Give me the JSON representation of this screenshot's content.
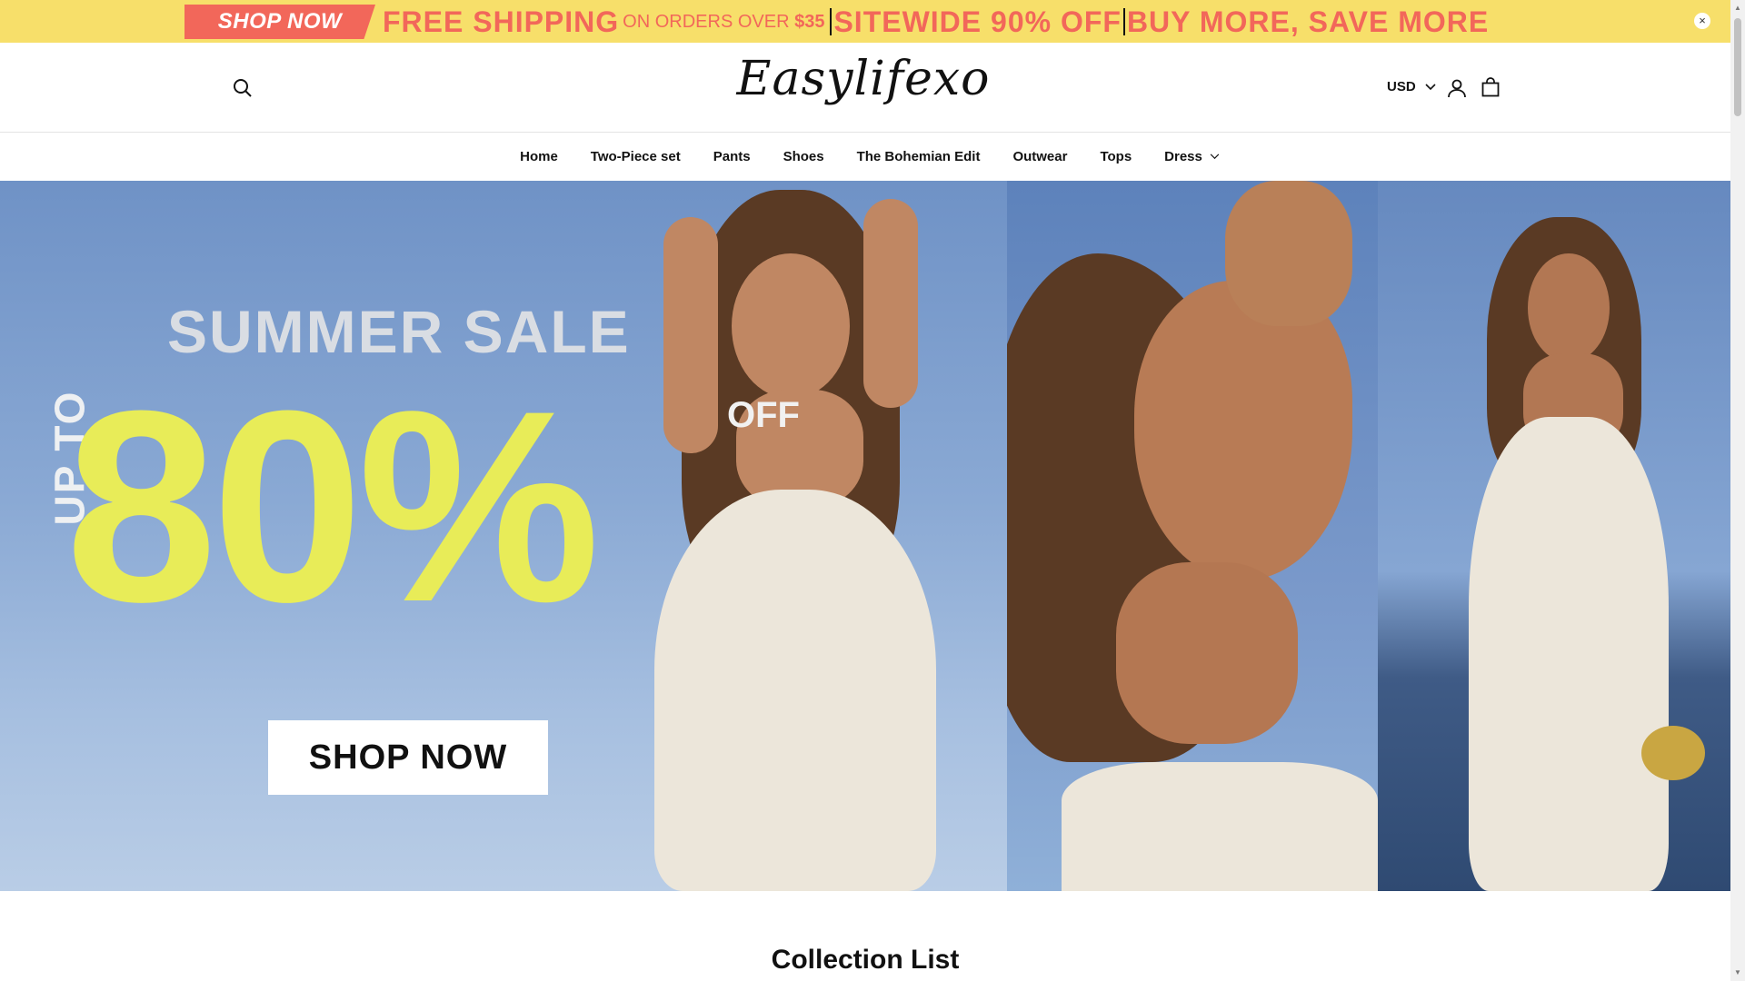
{
  "announcement": {
    "tag": "SHOP NOW",
    "free_shipping": "FREE SHIPPING",
    "orders_over": "ON ORDERS OVER",
    "amount": "$35",
    "sitewide": "SITEWIDE 90% OFF",
    "buy_more": "BUY MORE, SAVE MORE",
    "close": "×"
  },
  "header": {
    "logo": "Easylifexo",
    "currency": "USD"
  },
  "nav": {
    "items": [
      "Home",
      "Two-Piece set",
      "Pants",
      "Shoes",
      "The Bohemian Edit",
      "Outwear",
      "Tops",
      "Dress"
    ]
  },
  "hero": {
    "headline": "SUMMER SALE",
    "up_to": "UP TO",
    "percent": "80%",
    "off": "OFF",
    "cta": "SHOP NOW"
  },
  "collection": {
    "title": "Collection List"
  },
  "colors": {
    "announcement_bg": "#f7df6a",
    "accent": "#f2675a",
    "sale_yellow": "#e8ec58"
  },
  "icons": {
    "search": "search-icon",
    "account": "user-icon",
    "cart": "shopping-bag-icon",
    "chevron": "chevron-down-icon",
    "close": "close-icon"
  }
}
